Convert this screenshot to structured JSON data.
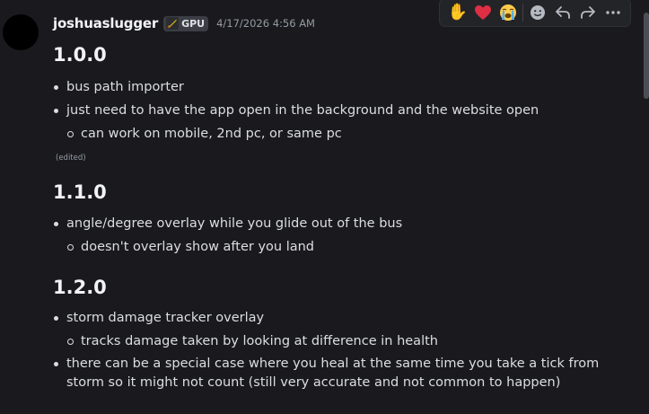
{
  "author": {
    "username": "joshuaslugger",
    "tag": "GPU",
    "timestamp": "4/17/2026 4:56 AM"
  },
  "toolbar": {
    "reactions": [
      {
        "name": "raised-hand",
        "glyph": "✋"
      },
      {
        "name": "red-heart",
        "glyph": "❤️"
      },
      {
        "name": "loudly-crying-face",
        "glyph": "😭"
      }
    ],
    "actions": [
      "add-reaction",
      "reply",
      "forward",
      "more"
    ]
  },
  "sections": [
    {
      "version": "1.0.0",
      "items": [
        {
          "text": "bus path importer"
        },
        {
          "text": "just need to have the app open in the background and the website open",
          "children": [
            {
              "text": "can work on mobile, 2nd pc, or same pc"
            }
          ]
        }
      ],
      "edited": "(edited)"
    },
    {
      "version": "1.1.0",
      "items": [
        {
          "text": "angle/degree overlay while you glide out of the bus",
          "children": [
            {
              "text": "doesn't overlay show after you land"
            }
          ]
        }
      ]
    },
    {
      "version": "1.2.0",
      "items": [
        {
          "text": "storm damage tracker overlay",
          "children": [
            {
              "text": "tracks damage taken by looking at difference in health"
            }
          ]
        },
        {
          "text": "there can be a special case where you heal at the same time you take a tick from storm so it might not count (still very accurate and not common to happen)"
        }
      ]
    }
  ],
  "colors": {
    "background": "#1a1a1e",
    "text": "#dbdee1",
    "heading": "#f2f3f5",
    "muted": "#949ba4",
    "toolbar_bg": "#232428"
  }
}
